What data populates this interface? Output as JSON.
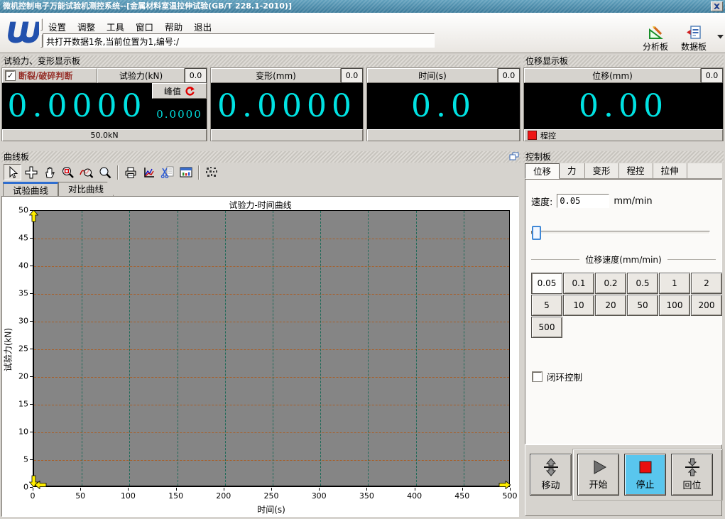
{
  "window": {
    "title": "微机控制电子万能试验机测控系统--[金属材料室温拉伸试验(GB/T 228.1-2010)]"
  },
  "menubar": {
    "items": [
      "设置",
      "调整",
      "工具",
      "窗口",
      "帮助",
      "退出"
    ]
  },
  "status_text": "共打开数据1条,当前位置为1,编号:/",
  "quick_tools": {
    "analysis": "分析板",
    "data": "数据板"
  },
  "force_panel": {
    "title": "试验力、变形显示板",
    "break_checkbox_label": "断裂/破碎判断",
    "break_checked": "✓",
    "force_label": "试验力(kN)",
    "force_overlay": "0.0",
    "force_value": "0.0000",
    "peak_label": "峰值",
    "peak_value": "0.0000",
    "range_label": "50.0kN",
    "deform_label": "变形(mm)",
    "deform_overlay": "0.0",
    "deform_value": "0.0000",
    "time_label": "时间(s)",
    "time_overlay": "0.0",
    "time_value": "0.0"
  },
  "displacement_panel": {
    "title": "位移显示板",
    "label": "位移(mm)",
    "overlay": "0.0",
    "value": "0.00",
    "mode_label": "程控"
  },
  "curve_panel": {
    "title": "曲线板",
    "toolbar_icons": [
      "pointer",
      "move",
      "pan",
      "zoom-region",
      "zoom-fit",
      "zoom",
      "print",
      "export-curve",
      "copy-curve",
      "curve-window",
      "grid-pattern"
    ],
    "tabs": [
      "试验曲线",
      "对比曲线"
    ],
    "active_tab": "试验曲线"
  },
  "chart_data": {
    "type": "line",
    "title": "试验力-时间曲线",
    "xlabel": "时间(s)",
    "ylabel": "试验力(kN)",
    "xlim": [
      0,
      500
    ],
    "ylim": [
      0,
      50
    ],
    "xticks": [
      0,
      50,
      100,
      150,
      200,
      250,
      300,
      350,
      400,
      450,
      500
    ],
    "yticks": [
      0,
      5,
      10,
      15,
      20,
      25,
      30,
      35,
      40,
      45,
      50
    ],
    "grid": true,
    "series": []
  },
  "control_panel": {
    "title": "控制板",
    "tabs": [
      "位移",
      "力",
      "变形",
      "程控",
      "拉伸"
    ],
    "active_tab": "位移",
    "speed_label": "速度:",
    "speed_value": "0.05",
    "speed_unit": "mm/min",
    "speed_group_title": "位移速度(mm/min)",
    "speed_options": [
      "0.05",
      "0.1",
      "0.2",
      "0.5",
      "1",
      "2",
      "5",
      "10",
      "20",
      "50",
      "100",
      "200",
      "500"
    ],
    "selected_speed": "0.05",
    "closed_loop_label": "闭环控制",
    "action_buttons": {
      "move": "移动",
      "start": "开始",
      "stop": "停止",
      "home": "回位"
    },
    "active_action": "停止"
  },
  "colors": {
    "display_digits": "#00e2e2",
    "title_bar": "#4286a5",
    "stop_button_bg": "#59c6ee",
    "alarm_red": "#ee1515",
    "break_text": "#96302a",
    "plot_bg": "#858585",
    "h_grid": "#a85f28",
    "v_grid": "#1e6a58",
    "axis_arrow": "#ffee00"
  }
}
